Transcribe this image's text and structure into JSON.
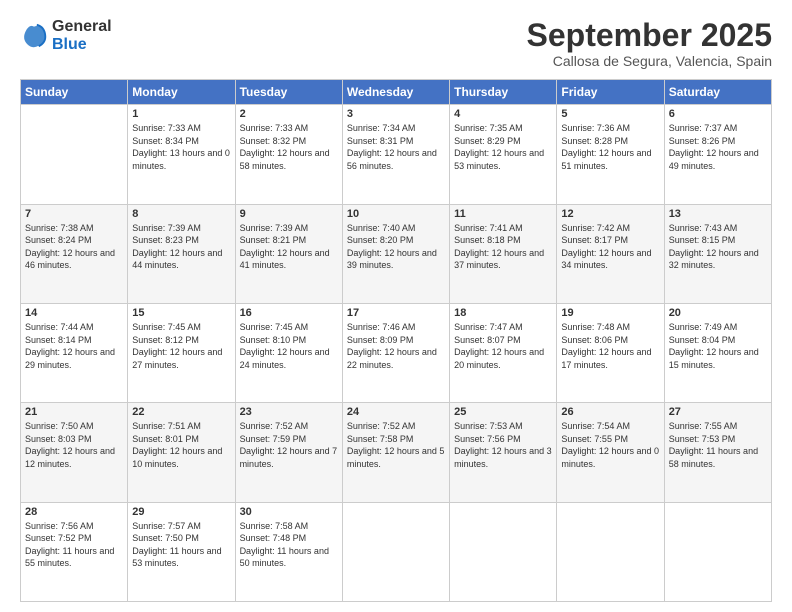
{
  "logo": {
    "general": "General",
    "blue": "Blue"
  },
  "header": {
    "month": "September 2025",
    "location": "Callosa de Segura, Valencia, Spain"
  },
  "days_of_week": [
    "Sunday",
    "Monday",
    "Tuesday",
    "Wednesday",
    "Thursday",
    "Friday",
    "Saturday"
  ],
  "weeks": [
    [
      {
        "day": "",
        "sunrise": "",
        "sunset": "",
        "daylight": ""
      },
      {
        "day": "1",
        "sunrise": "Sunrise: 7:33 AM",
        "sunset": "Sunset: 8:34 PM",
        "daylight": "Daylight: 13 hours and 0 minutes."
      },
      {
        "day": "2",
        "sunrise": "Sunrise: 7:33 AM",
        "sunset": "Sunset: 8:32 PM",
        "daylight": "Daylight: 12 hours and 58 minutes."
      },
      {
        "day": "3",
        "sunrise": "Sunrise: 7:34 AM",
        "sunset": "Sunset: 8:31 PM",
        "daylight": "Daylight: 12 hours and 56 minutes."
      },
      {
        "day": "4",
        "sunrise": "Sunrise: 7:35 AM",
        "sunset": "Sunset: 8:29 PM",
        "daylight": "Daylight: 12 hours and 53 minutes."
      },
      {
        "day": "5",
        "sunrise": "Sunrise: 7:36 AM",
        "sunset": "Sunset: 8:28 PM",
        "daylight": "Daylight: 12 hours and 51 minutes."
      },
      {
        "day": "6",
        "sunrise": "Sunrise: 7:37 AM",
        "sunset": "Sunset: 8:26 PM",
        "daylight": "Daylight: 12 hours and 49 minutes."
      }
    ],
    [
      {
        "day": "7",
        "sunrise": "Sunrise: 7:38 AM",
        "sunset": "Sunset: 8:24 PM",
        "daylight": "Daylight: 12 hours and 46 minutes."
      },
      {
        "day": "8",
        "sunrise": "Sunrise: 7:39 AM",
        "sunset": "Sunset: 8:23 PM",
        "daylight": "Daylight: 12 hours and 44 minutes."
      },
      {
        "day": "9",
        "sunrise": "Sunrise: 7:39 AM",
        "sunset": "Sunset: 8:21 PM",
        "daylight": "Daylight: 12 hours and 41 minutes."
      },
      {
        "day": "10",
        "sunrise": "Sunrise: 7:40 AM",
        "sunset": "Sunset: 8:20 PM",
        "daylight": "Daylight: 12 hours and 39 minutes."
      },
      {
        "day": "11",
        "sunrise": "Sunrise: 7:41 AM",
        "sunset": "Sunset: 8:18 PM",
        "daylight": "Daylight: 12 hours and 37 minutes."
      },
      {
        "day": "12",
        "sunrise": "Sunrise: 7:42 AM",
        "sunset": "Sunset: 8:17 PM",
        "daylight": "Daylight: 12 hours and 34 minutes."
      },
      {
        "day": "13",
        "sunrise": "Sunrise: 7:43 AM",
        "sunset": "Sunset: 8:15 PM",
        "daylight": "Daylight: 12 hours and 32 minutes."
      }
    ],
    [
      {
        "day": "14",
        "sunrise": "Sunrise: 7:44 AM",
        "sunset": "Sunset: 8:14 PM",
        "daylight": "Daylight: 12 hours and 29 minutes."
      },
      {
        "day": "15",
        "sunrise": "Sunrise: 7:45 AM",
        "sunset": "Sunset: 8:12 PM",
        "daylight": "Daylight: 12 hours and 27 minutes."
      },
      {
        "day": "16",
        "sunrise": "Sunrise: 7:45 AM",
        "sunset": "Sunset: 8:10 PM",
        "daylight": "Daylight: 12 hours and 24 minutes."
      },
      {
        "day": "17",
        "sunrise": "Sunrise: 7:46 AM",
        "sunset": "Sunset: 8:09 PM",
        "daylight": "Daylight: 12 hours and 22 minutes."
      },
      {
        "day": "18",
        "sunrise": "Sunrise: 7:47 AM",
        "sunset": "Sunset: 8:07 PM",
        "daylight": "Daylight: 12 hours and 20 minutes."
      },
      {
        "day": "19",
        "sunrise": "Sunrise: 7:48 AM",
        "sunset": "Sunset: 8:06 PM",
        "daylight": "Daylight: 12 hours and 17 minutes."
      },
      {
        "day": "20",
        "sunrise": "Sunrise: 7:49 AM",
        "sunset": "Sunset: 8:04 PM",
        "daylight": "Daylight: 12 hours and 15 minutes."
      }
    ],
    [
      {
        "day": "21",
        "sunrise": "Sunrise: 7:50 AM",
        "sunset": "Sunset: 8:03 PM",
        "daylight": "Daylight: 12 hours and 12 minutes."
      },
      {
        "day": "22",
        "sunrise": "Sunrise: 7:51 AM",
        "sunset": "Sunset: 8:01 PM",
        "daylight": "Daylight: 12 hours and 10 minutes."
      },
      {
        "day": "23",
        "sunrise": "Sunrise: 7:52 AM",
        "sunset": "Sunset: 7:59 PM",
        "daylight": "Daylight: 12 hours and 7 minutes."
      },
      {
        "day": "24",
        "sunrise": "Sunrise: 7:52 AM",
        "sunset": "Sunset: 7:58 PM",
        "daylight": "Daylight: 12 hours and 5 minutes."
      },
      {
        "day": "25",
        "sunrise": "Sunrise: 7:53 AM",
        "sunset": "Sunset: 7:56 PM",
        "daylight": "Daylight: 12 hours and 3 minutes."
      },
      {
        "day": "26",
        "sunrise": "Sunrise: 7:54 AM",
        "sunset": "Sunset: 7:55 PM",
        "daylight": "Daylight: 12 hours and 0 minutes."
      },
      {
        "day": "27",
        "sunrise": "Sunrise: 7:55 AM",
        "sunset": "Sunset: 7:53 PM",
        "daylight": "Daylight: 11 hours and 58 minutes."
      }
    ],
    [
      {
        "day": "28",
        "sunrise": "Sunrise: 7:56 AM",
        "sunset": "Sunset: 7:52 PM",
        "daylight": "Daylight: 11 hours and 55 minutes."
      },
      {
        "day": "29",
        "sunrise": "Sunrise: 7:57 AM",
        "sunset": "Sunset: 7:50 PM",
        "daylight": "Daylight: 11 hours and 53 minutes."
      },
      {
        "day": "30",
        "sunrise": "Sunrise: 7:58 AM",
        "sunset": "Sunset: 7:48 PM",
        "daylight": "Daylight: 11 hours and 50 minutes."
      },
      {
        "day": "",
        "sunrise": "",
        "sunset": "",
        "daylight": ""
      },
      {
        "day": "",
        "sunrise": "",
        "sunset": "",
        "daylight": ""
      },
      {
        "day": "",
        "sunrise": "",
        "sunset": "",
        "daylight": ""
      },
      {
        "day": "",
        "sunrise": "",
        "sunset": "",
        "daylight": ""
      }
    ]
  ]
}
